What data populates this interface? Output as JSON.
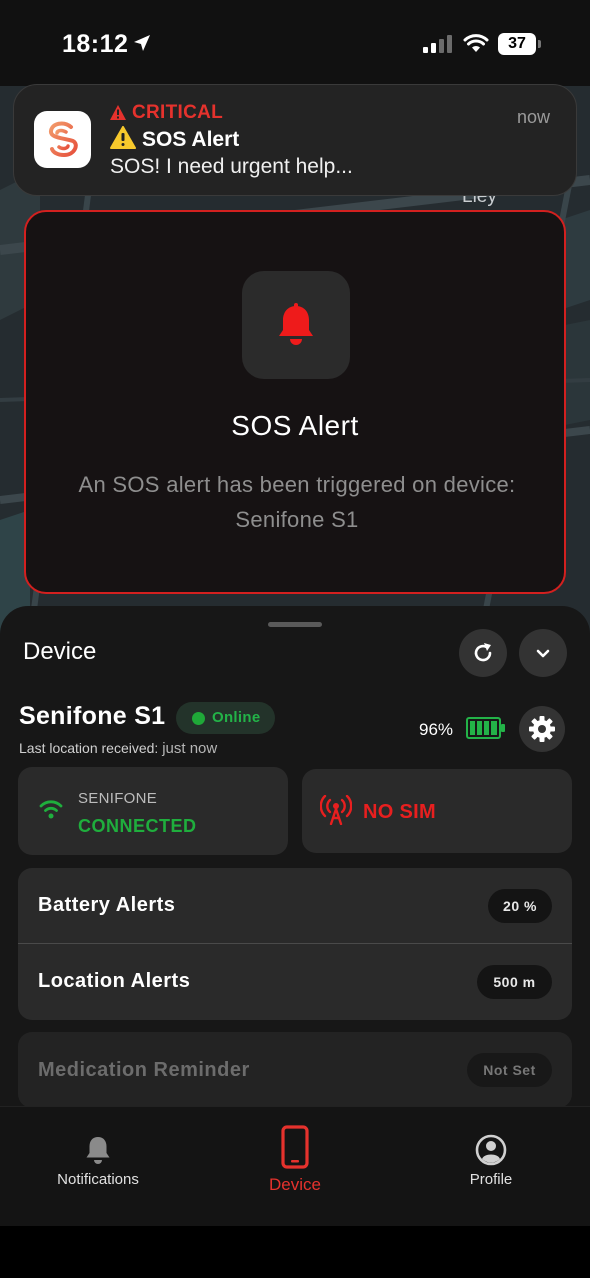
{
  "status_bar": {
    "time": "18:12",
    "battery_level": "37"
  },
  "map": {
    "label": "Lley"
  },
  "notification": {
    "level": "CRITICAL",
    "title": "SOS Alert",
    "body": "SOS! I need urgent help...",
    "time": "now",
    "app_icon": "senifone-app-icon"
  },
  "sos_modal": {
    "title": "SOS Alert",
    "message": "An SOS alert has been triggered on device: Senifone S1",
    "icon": "bell-icon",
    "accent": "#d3201f"
  },
  "device_sheet": {
    "title": "Device",
    "device_name": "Senifone S1",
    "status": "Online",
    "last_location_label": "Last location received:",
    "last_location_value": "just now",
    "battery_percent": "96%",
    "connection": {
      "label": "SENIFONE",
      "value": "CONNECTED",
      "color": "#1fae3d"
    },
    "sim": {
      "value": "NO SIM",
      "color": "#e81f1f"
    },
    "alerts": [
      {
        "label": "Battery Alerts",
        "value": "20 %"
      },
      {
        "label": "Location Alerts",
        "value": "500 m"
      }
    ],
    "medication": {
      "label": "Medication Reminder",
      "value": "Not Set"
    }
  },
  "tabs": [
    {
      "label": "Notifications",
      "icon": "bell-icon",
      "active": false
    },
    {
      "label": "Device",
      "icon": "phone-icon",
      "active": true,
      "color": "#e5322d"
    },
    {
      "label": "Profile",
      "icon": "profile-icon",
      "active": false
    }
  ]
}
